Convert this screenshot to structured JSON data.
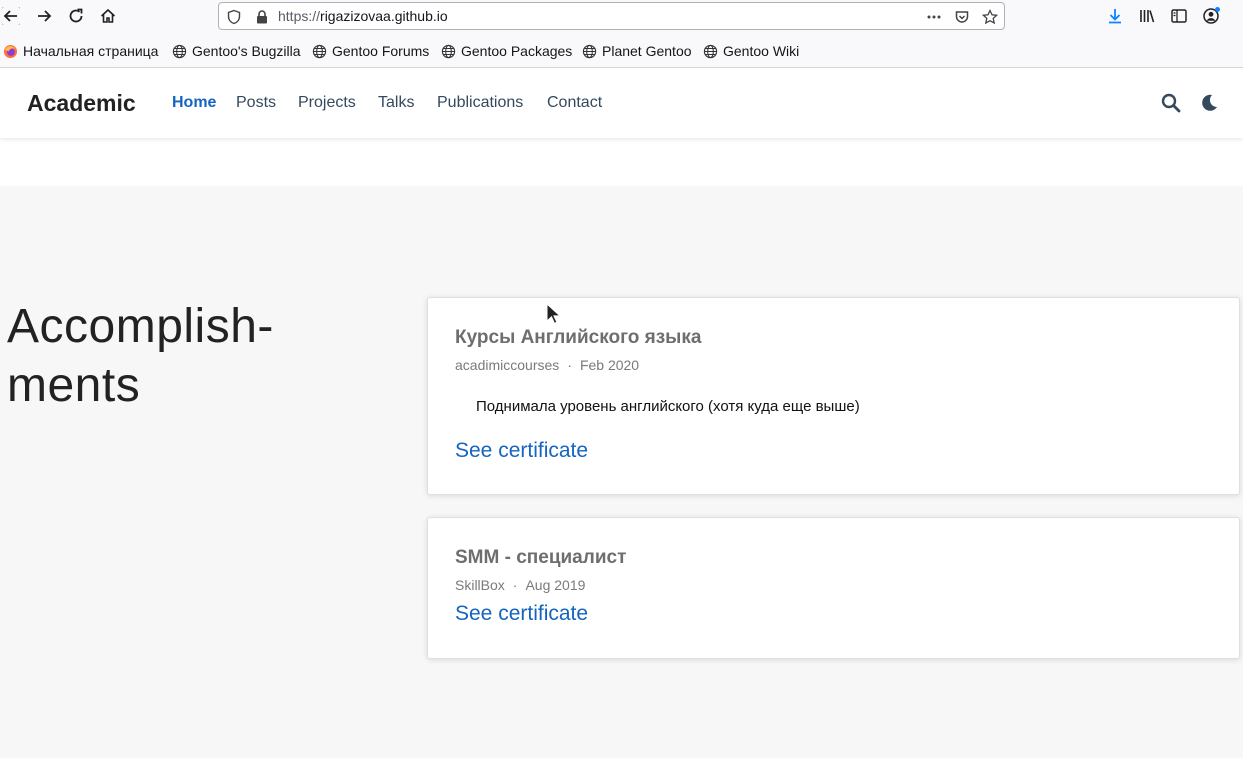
{
  "browser": {
    "url_scheme": "https://",
    "url_host": "rigazizovaa.github.io",
    "icons": [
      "back-icon",
      "forward-icon",
      "reload-icon",
      "home-icon",
      "shield-icon",
      "lock-icon",
      "more-icon",
      "pocket-icon",
      "star-icon",
      "download-icon",
      "library-icon",
      "sidebar-icon",
      "account-icon"
    ]
  },
  "bookmarks": [
    {
      "label": "Начальная страница",
      "icon": "firefox-icon"
    },
    {
      "label": "Gentoo's Bugzilla",
      "icon": "globe-icon"
    },
    {
      "label": "Gentoo Forums",
      "icon": "globe-icon"
    },
    {
      "label": "Gentoo Packages",
      "icon": "globe-icon"
    },
    {
      "label": "Planet Gentoo",
      "icon": "globe-icon"
    },
    {
      "label": "Gentoo Wiki",
      "icon": "globe-icon"
    }
  ],
  "site": {
    "brand": "Academic",
    "nav": [
      {
        "label": "Home",
        "active": true
      },
      {
        "label": "Posts",
        "active": false
      },
      {
        "label": "Projects",
        "active": false
      },
      {
        "label": "Talks",
        "active": false
      },
      {
        "label": "Publications",
        "active": false
      },
      {
        "label": "Contact",
        "active": false
      }
    ],
    "accent_color": "#1565c0"
  },
  "section": {
    "heading_line1": "Accomplish-",
    "heading_line2": "ments",
    "cards": [
      {
        "title": "Курсы Английского языка",
        "org": "acadimiccourses",
        "date": "Feb 2020",
        "description": "Поднимала уровень английского (хотя куда еще выше)",
        "link": "See certificate"
      },
      {
        "title": "SMM - специалист",
        "org": "SkillBox",
        "date": "Aug 2019",
        "link": "See certificate"
      }
    ]
  }
}
